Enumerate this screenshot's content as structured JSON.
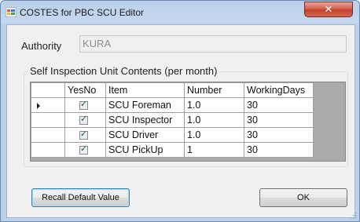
{
  "window": {
    "title": "COSTES for PBC SCU Editor",
    "close_label": "✕"
  },
  "authority": {
    "label": "Authority",
    "value": "KURA"
  },
  "group": {
    "title": "Self Inspection Unit Contents (per month)"
  },
  "table": {
    "columns": [
      "YesNo",
      "Item",
      "Number",
      "WorkingDays"
    ],
    "rows": [
      {
        "yesno": true,
        "item": "SCU Foreman",
        "number": "1.0",
        "working_days": "30",
        "current": true
      },
      {
        "yesno": true,
        "item": "SCU Inspector",
        "number": "1.0",
        "working_days": "30",
        "current": false
      },
      {
        "yesno": true,
        "item": "SCU Driver",
        "number": "1.0",
        "working_days": "30",
        "current": false
      },
      {
        "yesno": true,
        "item": "SCU PickUp",
        "number": "1",
        "working_days": "30",
        "current": false
      }
    ]
  },
  "buttons": {
    "recall": "Recall Default Value",
    "ok": "OK"
  },
  "colors": {
    "title_bar": "#c4d8ee",
    "close_button": "#c2412b",
    "client_background": "#f0f0f0",
    "grid_background": "#ababab"
  }
}
